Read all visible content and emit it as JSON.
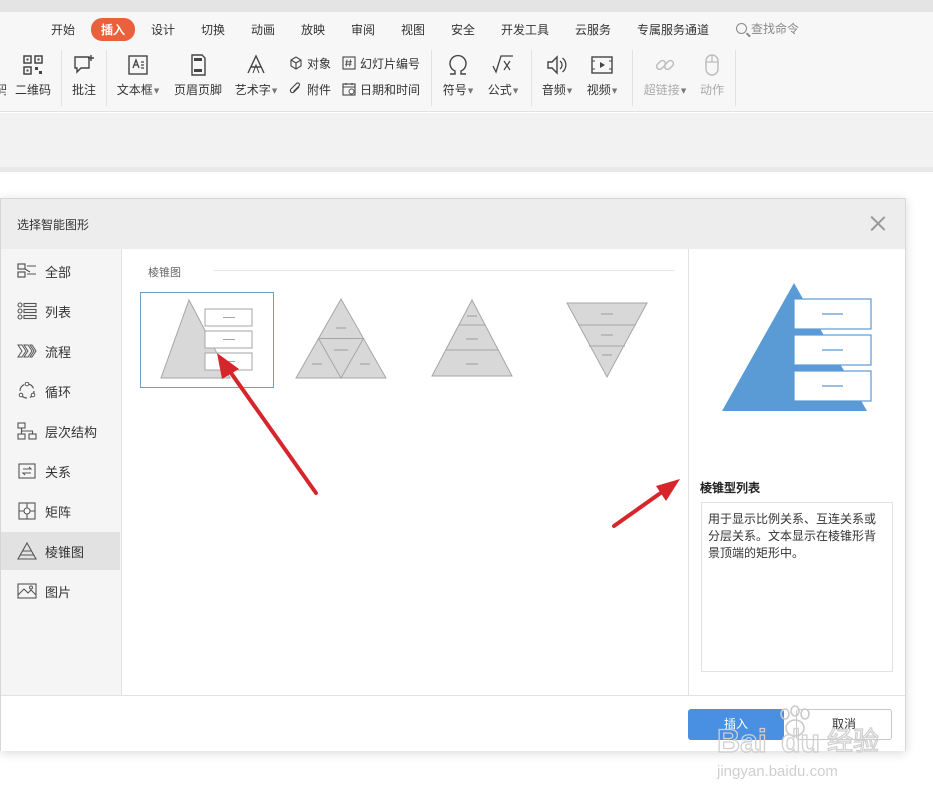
{
  "ribbon": {
    "tabs": [
      {
        "label": "开始",
        "active": false
      },
      {
        "label": "插入",
        "active": true
      },
      {
        "label": "设计",
        "active": false
      },
      {
        "label": "切换",
        "active": false
      },
      {
        "label": "动画",
        "active": false
      },
      {
        "label": "放映",
        "active": false
      },
      {
        "label": "审阅",
        "active": false
      },
      {
        "label": "视图",
        "active": false
      },
      {
        "label": "安全",
        "active": false
      },
      {
        "label": "开发工具",
        "active": false
      },
      {
        "label": "云服务",
        "active": false
      },
      {
        "label": "专属服务通道",
        "active": false
      }
    ],
    "search_label": "查找命令",
    "tools": {
      "partial": "码",
      "qrcode": "二维码",
      "comment": "批注",
      "textbox": "文本框",
      "header_footer": "页眉页脚",
      "wordart": "艺术字",
      "object": "对象",
      "attachment": "附件",
      "slide_number": "幻灯片编号",
      "datetime": "日期和时间",
      "symbol": "符号",
      "formula": "公式",
      "audio": "音频",
      "video": "视频",
      "hyperlink": "超链接",
      "action": "动作"
    }
  },
  "dialog": {
    "title": "选择智能图形",
    "sidebar": [
      {
        "label": "全部",
        "icon": "list-all-icon"
      },
      {
        "label": "列表",
        "icon": "list-icon"
      },
      {
        "label": "流程",
        "icon": "process-icon"
      },
      {
        "label": "循环",
        "icon": "cycle-icon"
      },
      {
        "label": "层次结构",
        "icon": "hierarchy-icon"
      },
      {
        "label": "关系",
        "icon": "relationship-icon"
      },
      {
        "label": "矩阵",
        "icon": "matrix-icon"
      },
      {
        "label": "棱锥图",
        "icon": "pyramid-icon",
        "active": true
      },
      {
        "label": "图片",
        "icon": "picture-icon"
      }
    ],
    "section_title": "棱锥图",
    "preview": {
      "title": "棱锥型列表",
      "description": "用于显示比例关系、互连关系或分层关系。文本显示在棱锥形背景顶端的矩形中。"
    },
    "insert_label": "插入",
    "cancel_label": "取消"
  },
  "colors": {
    "accent_tab": "#e9603c",
    "primary_button": "#4a90e2",
    "preview_shape": "#5b9bd5",
    "annotation_arrow": "#d6262c"
  },
  "watermark": {
    "line1": "Bai du 经验",
    "line2": "jingyan.baidu.com"
  }
}
